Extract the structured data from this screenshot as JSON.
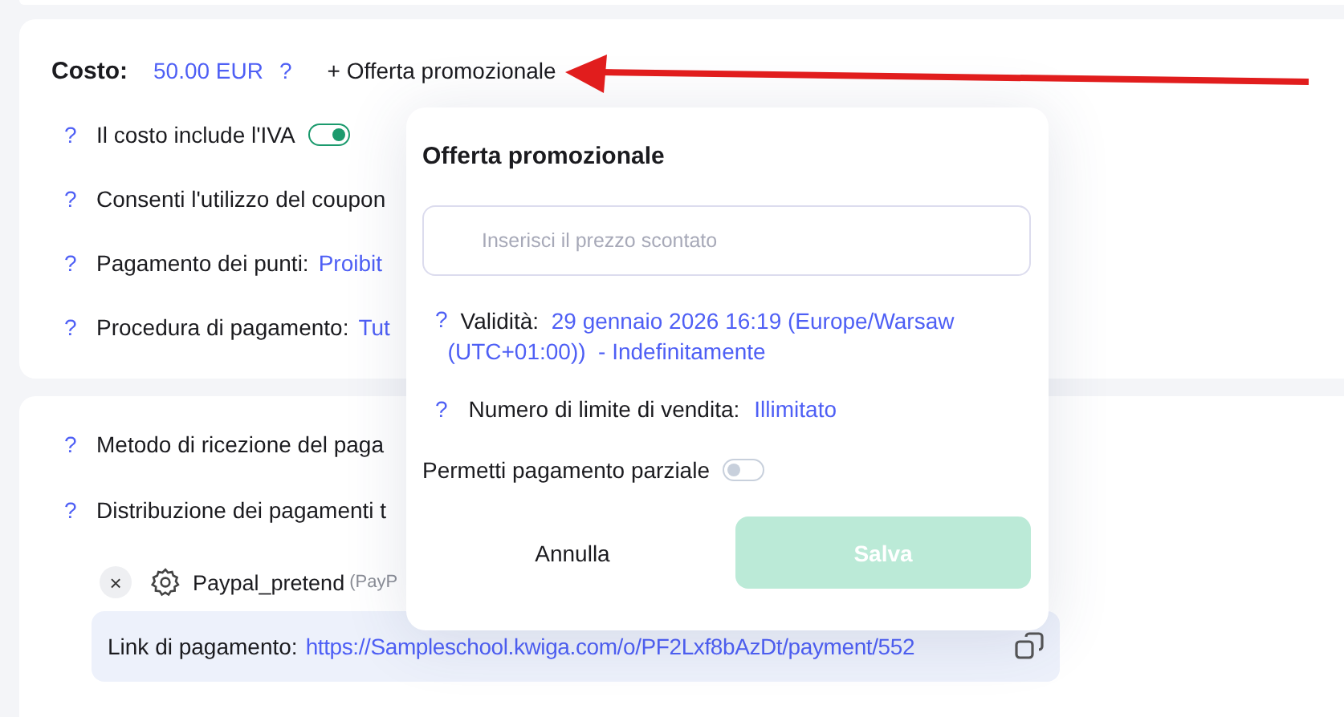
{
  "price_row": {
    "label": "Costo:",
    "value": "50.00 EUR",
    "help": "?",
    "promo_link": "+ Offerta promozionale"
  },
  "settings": [
    {
      "kind": "toggle",
      "help": "?",
      "label": "Il costo include l'IVA",
      "on": true
    },
    {
      "kind": "text",
      "help": "?",
      "label": "Consenti l'utilizzo del coupon"
    },
    {
      "kind": "value",
      "help": "?",
      "label": "Pagamento dei punti:",
      "value": "Proibit"
    },
    {
      "kind": "value",
      "help": "?",
      "label": "Procedura di pagamento:",
      "value": "Tut"
    }
  ],
  "payment": {
    "rows": [
      {
        "help": "?",
        "label": "Metodo di ricezione del paga"
      },
      {
        "help": "?",
        "label": "Distribuzione dei pagamenti t"
      }
    ],
    "method": {
      "remove": "×",
      "name": "Paypal_pretend",
      "provider": "(PayP"
    },
    "link": {
      "label": "Link di pagamento:",
      "url": "https://Sampleschool.kwiga.com/o/PF2Lxf8bAzDt/payment/552"
    }
  },
  "popover": {
    "title": "Offerta promozionale",
    "price_field": {
      "placeholder": "Inserisci il prezzo scontato"
    },
    "validity": {
      "help": "?",
      "label": "Validità:",
      "value": "29 gennaio 2026 16:19 (Europe/Warsaw (UTC+01:00))",
      "suffix": "- Indefinitamente"
    },
    "limit": {
      "help": "?",
      "label": "Numero di limite di vendita:",
      "value": "Illimitato"
    },
    "partial_payment": {
      "label": "Permetti pagamento parziale",
      "on": false
    },
    "buttons": [
      {
        "kind": "secondary",
        "label": "Annulla",
        "disabled": false
      },
      {
        "kind": "primary",
        "label": "Salva",
        "disabled": true
      }
    ]
  }
}
